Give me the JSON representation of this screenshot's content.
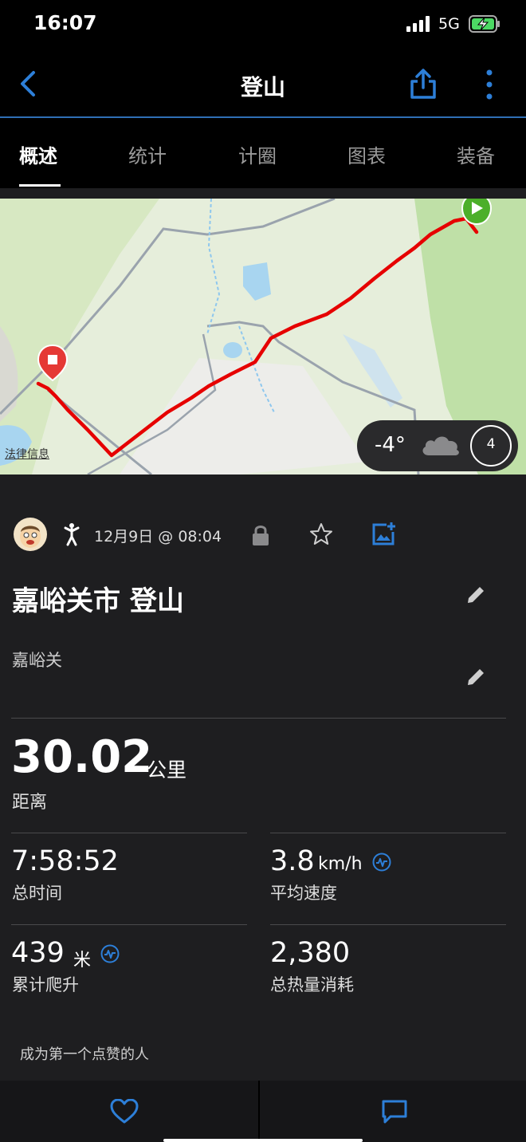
{
  "status": {
    "time": "16:07",
    "network": "5G"
  },
  "nav": {
    "title": "登山"
  },
  "tabs": [
    "概述",
    "统计",
    "计圈",
    "图表",
    "装备"
  ],
  "map": {
    "legal": "法律信息",
    "weather_temp": "-4°",
    "moon_phase": "4"
  },
  "activity": {
    "date": "12月9日 @ 08:04",
    "title": "嘉峪关市 登山",
    "location": "嘉峪关"
  },
  "stats": {
    "distance": {
      "value": "30.02",
      "unit": "公里",
      "label": "距离"
    },
    "total_time": {
      "value": "7:58:52",
      "label": "总时间"
    },
    "avg_speed": {
      "value": "3.8",
      "unit": "km/h",
      "label": "平均速度"
    },
    "elevation_gain": {
      "value": "439",
      "unit": "米",
      "label": "累计爬升"
    },
    "calories": {
      "value": "2,380",
      "label": "总热量消耗"
    }
  },
  "social": {
    "likes_prompt": "成为第一个点赞的人"
  },
  "colors": {
    "accent": "#2d7fd8",
    "route": "#e60000",
    "start": "#4caf2a",
    "end": "#e53935"
  }
}
